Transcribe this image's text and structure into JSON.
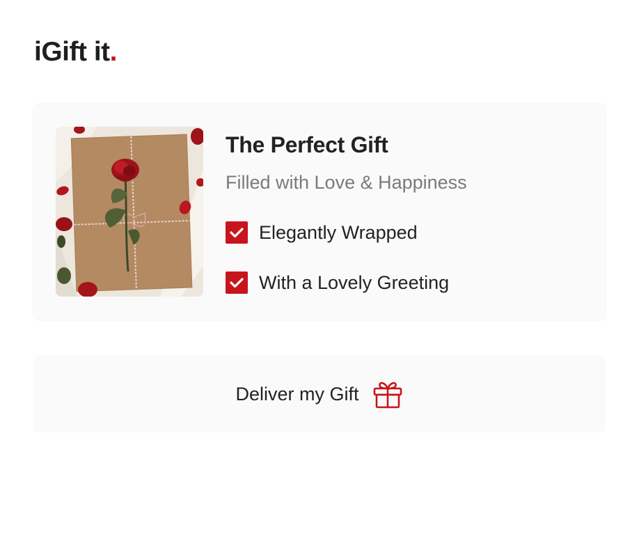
{
  "brand": {
    "name": "iGift it",
    "dot": ".",
    "accent_color": "#c8141c"
  },
  "product": {
    "image_icon": "gift-with-rose-image",
    "title": "The Perfect Gift",
    "subtitle": "Filled with Love & Happiness",
    "features": [
      {
        "label": "Elegantly Wrapped",
        "checked": true,
        "icon": "check-icon"
      },
      {
        "label": "With a Lovely Greeting",
        "checked": true,
        "icon": "check-icon"
      }
    ]
  },
  "action": {
    "deliver_label": "Deliver my Gift",
    "icon": "gift-icon"
  }
}
